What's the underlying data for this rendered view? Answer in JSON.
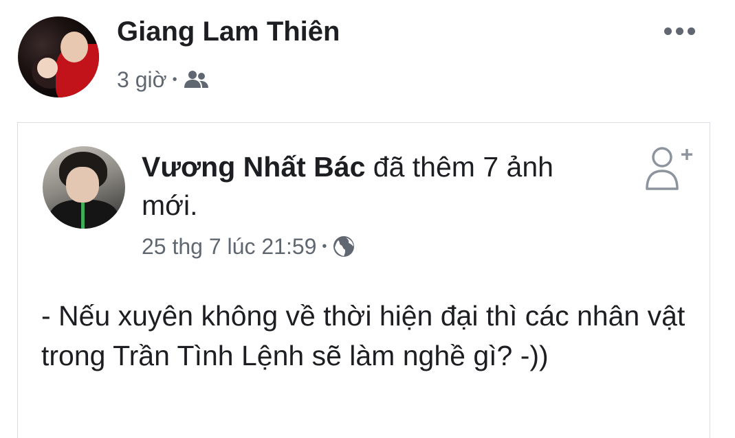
{
  "post": {
    "author": "Giang Lam Thiên",
    "time": "3 giờ",
    "separator": "•",
    "audience_icon": "friends-icon",
    "more_icon": "more-options-icon"
  },
  "shared_post": {
    "author": "Vương Nhất Bác",
    "action": " đã thêm 7 ảnh mới.",
    "timestamp": "25 thg 7 lúc 21:59",
    "separator": "•",
    "privacy_icon": "globe-icon",
    "follow_icon": "add-friend-icon",
    "body": "- Nếu xuyên không về thời hiện đại thì các nhân vật trong Trần Tình Lệnh sẽ làm nghề gì? -))"
  },
  "colors": {
    "text_primary": "#1c1e21",
    "text_secondary": "#606770",
    "border": "#dadde1",
    "icon_gray": "#8d949e"
  }
}
